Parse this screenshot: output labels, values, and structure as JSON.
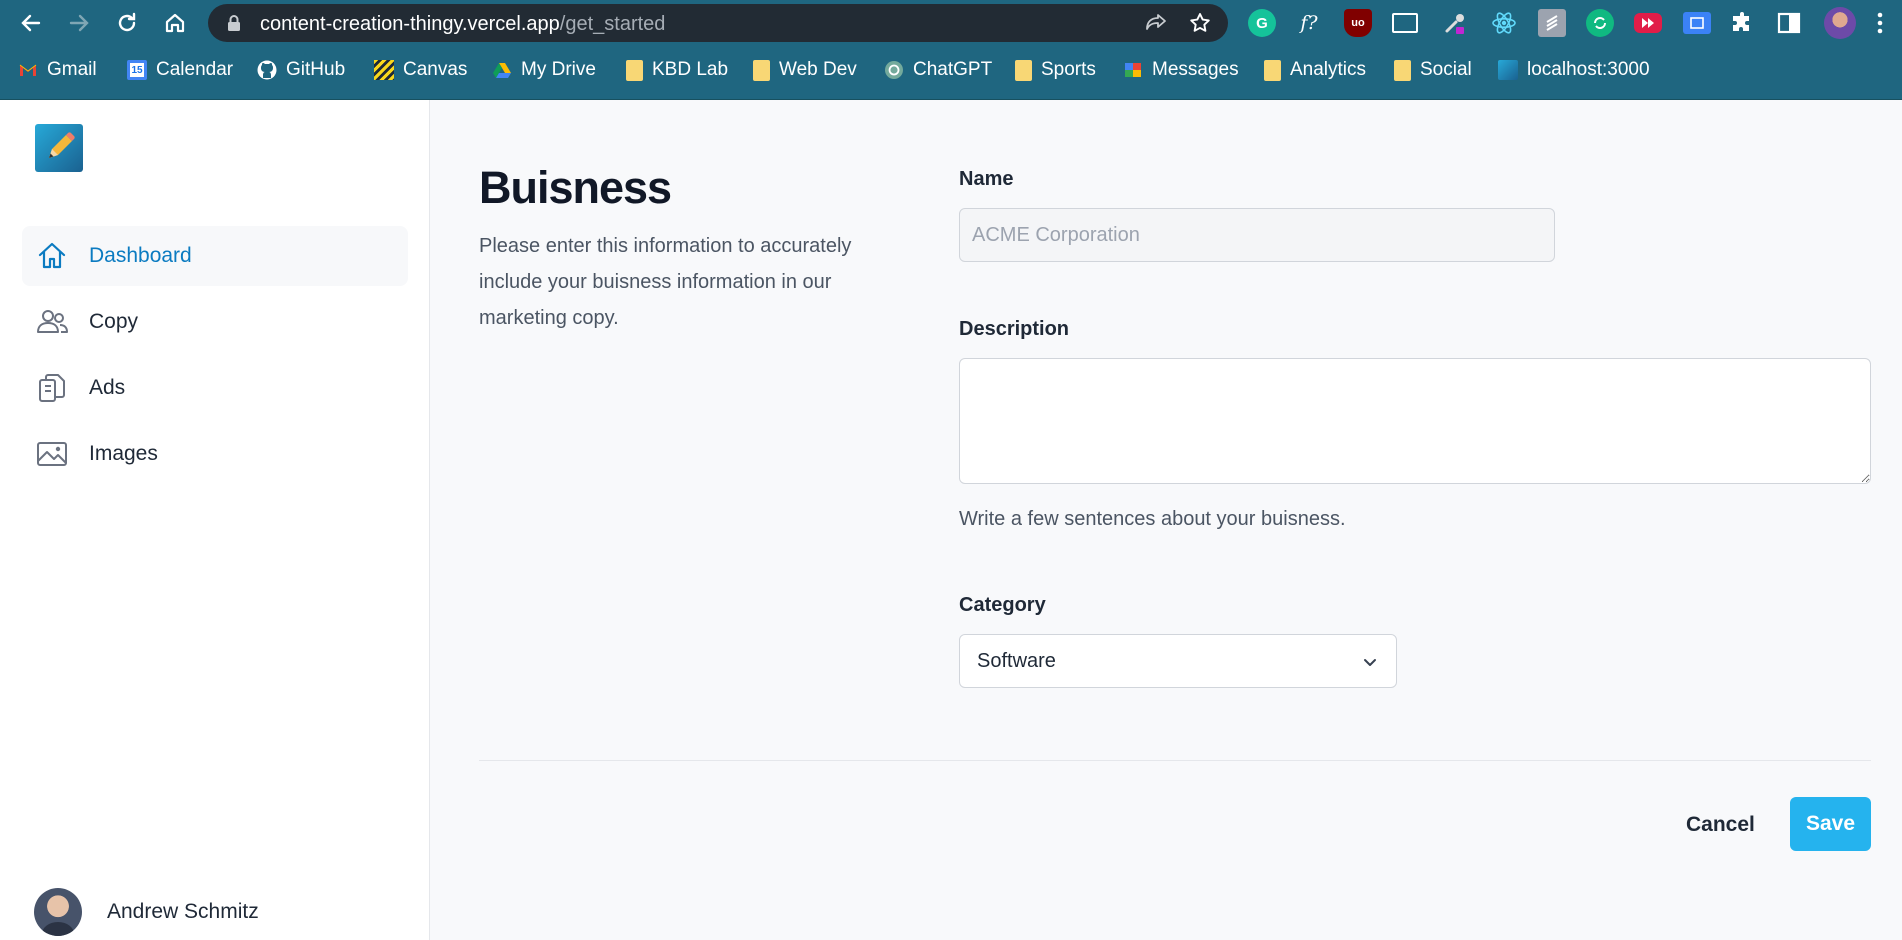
{
  "browser": {
    "url_host": "content-creation-thingy.vercel.app",
    "url_path": "/get_started",
    "extension_labels": {
      "typography": "f?",
      "ublock": "uo"
    },
    "bookmarks": [
      {
        "label": "Gmail",
        "icon": "gmail-icon"
      },
      {
        "label": "Calendar",
        "icon": "calendar-icon",
        "badge": "15"
      },
      {
        "label": "GitHub",
        "icon": "github-icon"
      },
      {
        "label": "Canvas",
        "icon": "canvas-icon"
      },
      {
        "label": "My Drive",
        "icon": "drive-icon"
      },
      {
        "label": "KBD Lab",
        "icon": "folder-icon"
      },
      {
        "label": "Web Dev",
        "icon": "folder-icon"
      },
      {
        "label": "ChatGPT",
        "icon": "chatgpt-icon"
      },
      {
        "label": "Sports",
        "icon": "folder-icon"
      },
      {
        "label": "Messages",
        "icon": "messages-icon"
      },
      {
        "label": "Analytics",
        "icon": "folder-icon"
      },
      {
        "label": "Social",
        "icon": "folder-icon"
      },
      {
        "label": "localhost:3000",
        "icon": "localhost-icon"
      }
    ]
  },
  "sidebar": {
    "items": [
      {
        "label": "Dashboard",
        "icon": "home-icon",
        "active": true
      },
      {
        "label": "Copy",
        "icon": "users-icon"
      },
      {
        "label": "Ads",
        "icon": "clipboard-icon"
      },
      {
        "label": "Images",
        "icon": "image-icon"
      }
    ],
    "user": {
      "name": "Andrew Schmitz"
    }
  },
  "form": {
    "title": "Buisness",
    "description": "Please enter this information to accurately include your buisness information in our marketing copy.",
    "name_label": "Name",
    "name_placeholder": "ACME Corporation",
    "name_value": "",
    "description_label": "Description",
    "description_value": "",
    "description_help": "Write a few sentences about your buisness.",
    "category_label": "Category",
    "category_value": "Software",
    "cancel_label": "Cancel",
    "save_label": "Save"
  },
  "colors": {
    "chrome": "#1f6680",
    "accent": "#25b3ee",
    "active_nav": "#0b7bc1"
  }
}
